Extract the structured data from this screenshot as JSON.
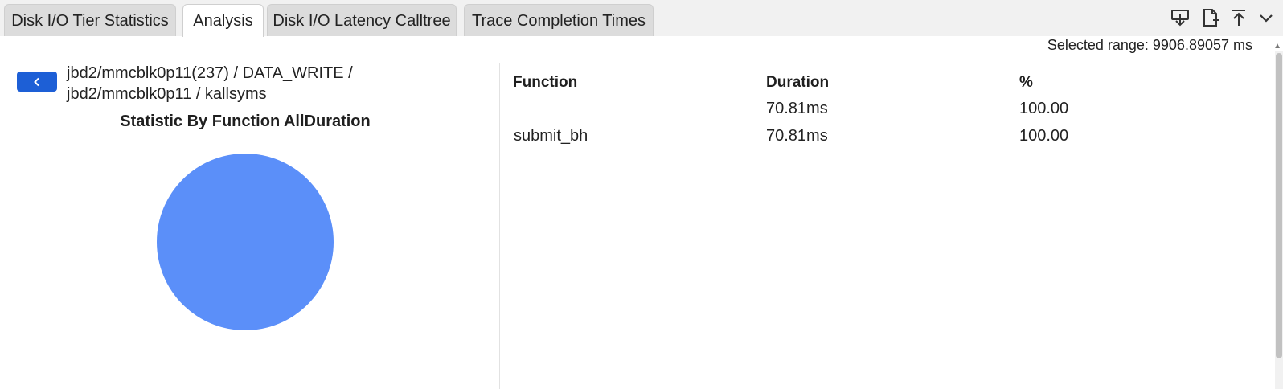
{
  "tabs": [
    {
      "label": "Disk I/O Tier Statistics",
      "active": false
    },
    {
      "label": "Analysis",
      "active": true
    },
    {
      "label": "Disk I/O Latency Calltree",
      "active": false
    },
    {
      "label": "Trace Completion Times",
      "active": false
    }
  ],
  "toolbar": {
    "icons": [
      "download-icon",
      "new-file-icon",
      "upload-icon",
      "chevron-down-icon"
    ]
  },
  "selected_range": "Selected range: 9906.89057 ms",
  "breadcrumb": {
    "line1": "jbd2/mmcblk0p11(237) / DATA_WRITE /",
    "line2": "jbd2/mmcblk0p11 / kallsyms"
  },
  "chart_data": {
    "type": "pie",
    "title": "Statistic By Function AllDuration",
    "slices": [
      {
        "label": "submit_bh",
        "value": 100.0,
        "color": "#5b8ff9"
      }
    ]
  },
  "table": {
    "headers": {
      "function": "Function",
      "duration": "Duration",
      "percent": "%"
    },
    "rows": [
      {
        "function": "",
        "duration": "70.81ms",
        "percent": "100.00"
      },
      {
        "function": "submit_bh",
        "duration": "70.81ms",
        "percent": "100.00"
      }
    ]
  },
  "colors": {
    "accent": "#1d5fd6",
    "pie": "#5b8ff9"
  }
}
